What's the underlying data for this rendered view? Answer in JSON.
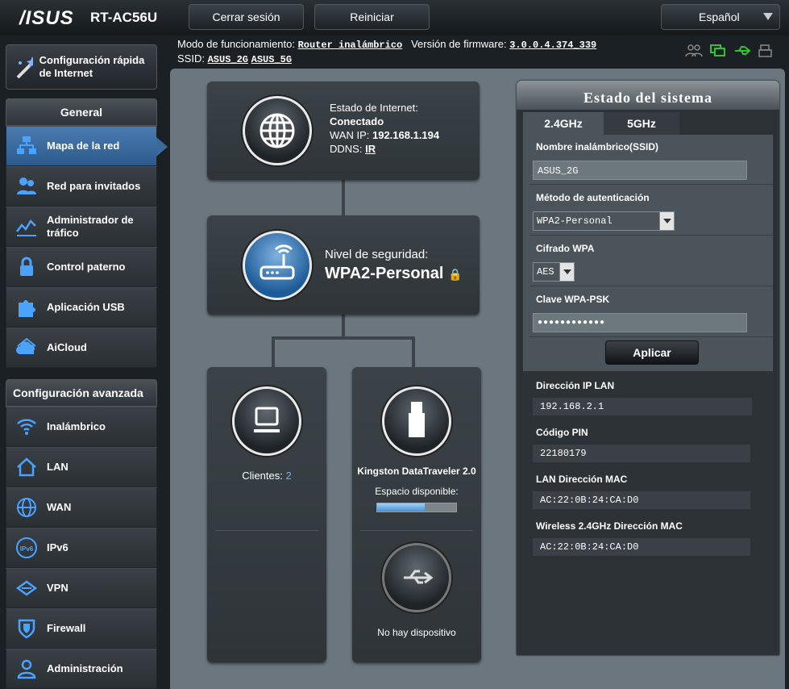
{
  "header": {
    "logo": "/ISUS",
    "model": "RT-AC56U",
    "logout": "Cerrar sesión",
    "reboot": "Reiniciar",
    "language": "Español"
  },
  "info": {
    "mode_label": "Modo de funcionamiento:",
    "mode_value": "Router inalámbrico",
    "fw_label": "Versión de firmware:",
    "fw_value": "3.0.0.4.374_339",
    "ssid_label": "SSID:",
    "ssid_1": "ASUS_2G",
    "ssid_2": "ASUS_5G"
  },
  "sidebar": {
    "quick": "Configuración rápida de Internet",
    "general_title": "General",
    "general": [
      {
        "label": "Mapa de la red",
        "icon": "network-map-icon"
      },
      {
        "label": "Red para invitados",
        "icon": "guests-icon"
      },
      {
        "label": "Administrador de tráfico",
        "icon": "traffic-icon"
      },
      {
        "label": "Control paterno",
        "icon": "lock-icon"
      },
      {
        "label": "Aplicación USB",
        "icon": "puzzle-icon"
      },
      {
        "label": "AiCloud",
        "icon": "cloud-icon"
      }
    ],
    "advanced_title": "Configuración avanzada",
    "advanced": [
      {
        "label": "Inalámbrico",
        "icon": "wifi-icon"
      },
      {
        "label": "LAN",
        "icon": "house-icon"
      },
      {
        "label": "WAN",
        "icon": "globe-icon"
      },
      {
        "label": "IPv6",
        "icon": "ipv6-icon"
      },
      {
        "label": "VPN",
        "icon": "vpn-icon"
      },
      {
        "label": "Firewall",
        "icon": "shield-icon"
      },
      {
        "label": "Administración",
        "icon": "admin-icon"
      }
    ]
  },
  "map": {
    "internet_label": "Estado de Internet:",
    "internet_status": "Conectado",
    "wan_label": "WAN IP:",
    "wan_ip": "192.168.1.194",
    "ddns_label": "DDNS:",
    "ddns_value": "IR",
    "security_label": "Nivel de seguridad:",
    "security_value": "WPA2-Personal",
    "clients_label": "Clientes:",
    "clients_count": "2",
    "usb_name": "Kingston DataTraveler 2.0",
    "usb_space_label": "Espacio disponible:",
    "usb_space_fraction": 0.6,
    "usb2_text": "No hay dispositivo"
  },
  "status": {
    "title": "Estado del sistema",
    "tab_24": "2.4GHz",
    "tab_5": "5GHz",
    "ssid_label": "Nombre inalámbrico(SSID)",
    "ssid_value": "ASUS_2G",
    "auth_label": "Método de autenticación",
    "auth_value": "WPA2-Personal",
    "enc_label": "Cifrado WPA",
    "enc_value": "AES",
    "psk_label": "Clave WPA-PSK",
    "psk_value": "●●●●●●●●●●●●",
    "apply": "Aplicar",
    "lan_ip_label": "Dirección IP LAN",
    "lan_ip": "192.168.2.1",
    "pin_label": "Código PIN",
    "pin": "22180179",
    "mac_label": "LAN Dirección MAC",
    "mac": "AC:22:0B:24:CA:D0",
    "wmac_label": "Wireless 2.4GHz Dirección MAC",
    "wmac": "AC:22:0B:24:CA:D0"
  }
}
